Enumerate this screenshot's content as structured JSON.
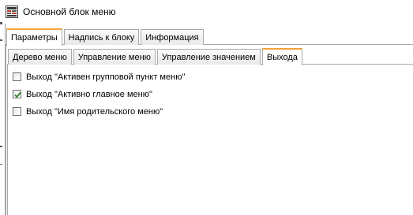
{
  "window": {
    "title": "Основной блок меню",
    "icon": "menu-block-app-icon"
  },
  "top_tabs": [
    {
      "label": "Параметры",
      "active": true
    },
    {
      "label": "Надпись к блоку",
      "active": false
    },
    {
      "label": "Информация",
      "active": false
    }
  ],
  "sub_tabs": [
    {
      "label": "Дерево меню",
      "active": false
    },
    {
      "label": "Управление меню",
      "active": false
    },
    {
      "label": "Управление значением",
      "active": false
    },
    {
      "label": "Выхода",
      "active": true
    }
  ],
  "options": [
    {
      "label": "Выход \"Активен групповой пункт меню\"",
      "checked": false
    },
    {
      "label": "Выход \"Активно главное меню\"",
      "checked": true
    },
    {
      "label": "Выход \"Имя родительского меню\"",
      "checked": false
    }
  ],
  "colors": {
    "active_tab_accent": "#f2a23a",
    "check_mark": "#2f7d2f",
    "border": "#a9a9a9"
  }
}
